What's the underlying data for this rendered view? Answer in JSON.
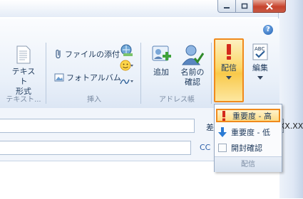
{
  "window": {
    "controls": {
      "minimize": "—",
      "maximize": "☐",
      "close": "✕"
    }
  },
  "ribbon": {
    "text_format": {
      "label_line1": "テキスト",
      "label_line2": "形式",
      "group": "テキスト..."
    },
    "insert": {
      "attach_file": "ファイルの添付",
      "photo_album": "フォトアルバム",
      "group": "挿入"
    },
    "address_book": {
      "add": "追加",
      "check_names_line1": "名前の",
      "check_names_line2": "確認",
      "group": "アドレス帳"
    },
    "delivery": {
      "label": "配信"
    },
    "edit": {
      "label": "編集"
    },
    "help": "?"
  },
  "form": {
    "sender_label": "差出人",
    "sender_value": "XXXX@XXX.XX.X",
    "cc_label": "CC"
  },
  "delivery_menu": {
    "items": [
      {
        "label": "重要度 - 高",
        "icon": "exclamation-icon",
        "highlighted": true
      },
      {
        "label": "重要度 - 低",
        "icon": "down-arrow-icon",
        "highlighted": false
      },
      {
        "label": "開封確認",
        "icon": "checkbox-icon",
        "highlighted": false
      }
    ],
    "footer": "配信"
  },
  "colors": {
    "accent_orange": "#f08a1c",
    "ribbon_text": "#1e395b",
    "importance_red": "#d42a1c",
    "importance_blue": "#2b7bd4"
  }
}
